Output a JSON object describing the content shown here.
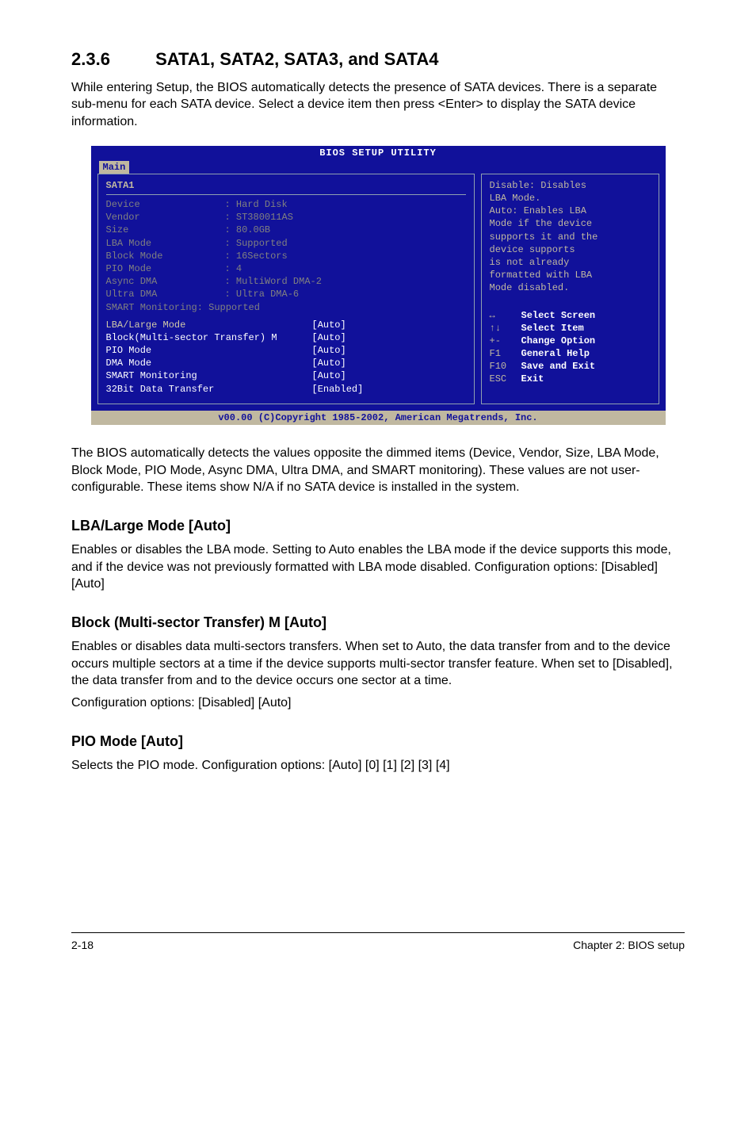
{
  "section": {
    "number": "2.3.6",
    "title": "SATA1, SATA2, SATA3, and SATA4",
    "intro": "While entering Setup, the BIOS automatically detects the presence of SATA devices. There is a separate sub-menu for each SATA device. Select a device item then press <Enter> to display the SATA device information."
  },
  "bios": {
    "title": "BIOS SETUP UTILITY",
    "tab": "Main",
    "subtitle": "SATA1",
    "device": [
      {
        "label": "Device",
        "value": ": Hard Disk"
      },
      {
        "label": "Vendor",
        "value": ": ST380011AS"
      },
      {
        "label": "Size",
        "value": ": 80.0GB"
      },
      {
        "label": "LBA Mode",
        "value": ": Supported"
      },
      {
        "label": "Block Mode",
        "value": ": 16Sectors"
      },
      {
        "label": "PIO Mode",
        "value": ": 4"
      },
      {
        "label": "Async DMA",
        "value": ": MultiWord DMA-2"
      },
      {
        "label": "Ultra DMA",
        "value": ": Ultra DMA-6"
      },
      {
        "label": "SMART Monitoring: Supported",
        "value": ""
      }
    ],
    "settings": [
      {
        "label": "LBA/Large Mode",
        "value": "[Auto]"
      },
      {
        "label": "Block(Multi-sector Transfer) M",
        "value": "[Auto]"
      },
      {
        "label": "PIO Mode",
        "value": "[Auto]"
      },
      {
        "label": "DMA Mode",
        "value": "[Auto]"
      },
      {
        "label": "SMART Monitoring",
        "value": "[Auto]"
      },
      {
        "label": "32Bit Data Transfer",
        "value": "[Enabled]"
      }
    ],
    "help": "Disable: Disables LBA Mode.\nAuto: Enables LBA Mode if the device supports it and the device supports is not already formatted with LBA Mode disabled.",
    "helpDisable": "Disable: Disables",
    "helpLba": "LBA Mode.",
    "helpAuto1": "Auto: Enables LBA",
    "helpAuto2": "Mode if the device",
    "helpAuto3": "supports it and the",
    "helpAuto4": "device supports",
    "helpAuto5": "is not already",
    "helpAuto6": "formatted with LBA",
    "helpAuto7": "Mode disabled.",
    "keys": [
      {
        "sym": "↔",
        "label": "Select Screen"
      },
      {
        "sym": "↑↓",
        "label": "Select Item"
      },
      {
        "sym": "+-",
        "label": "Change Option"
      },
      {
        "sym": "F1",
        "label": "General Help"
      },
      {
        "sym": "F10",
        "label": "Save and Exit"
      },
      {
        "sym": "ESC",
        "label": "Exit"
      }
    ],
    "footer": "v00.00 (C)Copyright 1985-2002, American Megatrends, Inc."
  },
  "afterBios": "The BIOS automatically detects the values opposite the dimmed items (Device, Vendor, Size, LBA Mode, Block Mode, PIO Mode, Async DMA, Ultra DMA, and SMART monitoring). These values are not user-configurable. These items show N/A if no SATA device is installed in the system.",
  "lba": {
    "heading": "LBA/Large Mode [Auto]",
    "body": "Enables or disables the LBA mode. Setting to Auto enables the LBA mode if the device supports this mode, and if the device was not previously formatted with LBA mode disabled. Configuration options: [Disabled] [Auto]"
  },
  "block": {
    "heading": "Block (Multi-sector Transfer) M [Auto]",
    "body1": "Enables or disables data multi-sectors transfers. When set to Auto, the data transfer from and to the device occurs multiple sectors at a time if the device supports multi-sector transfer feature. When set to [Disabled], the data transfer from and to the device occurs one sector at a time.",
    "body2": "Configuration options: [Disabled] [Auto]"
  },
  "pio": {
    "heading": "PIO Mode [Auto]",
    "body": "Selects the PIO mode. Configuration options: [Auto] [0] [1] [2] [3] [4]"
  },
  "pageFooter": {
    "left": "2-18",
    "right": "Chapter 2: BIOS setup"
  }
}
